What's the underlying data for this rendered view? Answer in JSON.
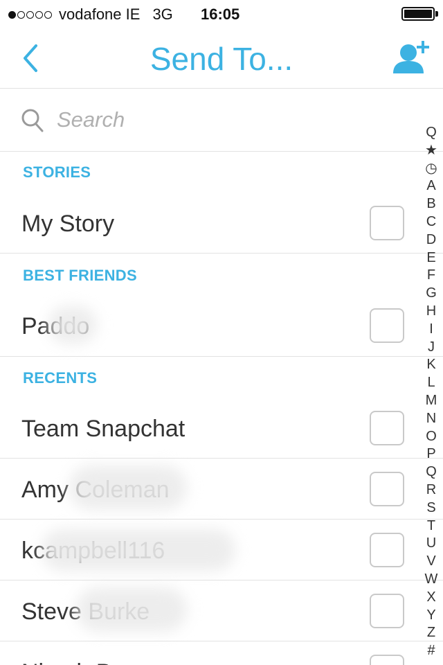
{
  "status_bar": {
    "carrier": "vodafone IE",
    "network": "3G",
    "time": "16:05",
    "signal_bars_filled": 1,
    "signal_bars_total": 5,
    "battery_level": 1.0
  },
  "nav": {
    "title": "Send To...",
    "back_icon": "chevron-left-icon",
    "add_friend_icon": "add-friend-icon"
  },
  "search": {
    "placeholder": "Search",
    "value": ""
  },
  "sections": {
    "stories": {
      "header": "STORIES",
      "items": [
        {
          "label": "My Story",
          "checked": false
        }
      ]
    },
    "best_friends": {
      "header": "BEST FRIENDS",
      "items": [
        {
          "label": "Paddo",
          "checked": false
        }
      ]
    },
    "recents": {
      "header": "RECENTS",
      "items": [
        {
          "label": "Team Snapchat",
          "checked": false
        },
        {
          "label": "Amy Coleman",
          "checked": false
        },
        {
          "label": "kcampbell116",
          "checked": false
        },
        {
          "label": "Steve Burke",
          "checked": false
        },
        {
          "label": "Niamh B",
          "checked": false
        }
      ]
    }
  },
  "index_bar": [
    "Q",
    "★",
    "◷",
    "A",
    "B",
    "C",
    "D",
    "E",
    "F",
    "G",
    "H",
    "I",
    "J",
    "K",
    "L",
    "M",
    "N",
    "O",
    "P",
    "Q",
    "R",
    "S",
    "T",
    "U",
    "V",
    "W",
    "X",
    "Y",
    "Z",
    "#"
  ],
  "colors": {
    "accent": "#3cb2e2",
    "text": "#333333",
    "divider": "#e2e2e2",
    "checkbox_border": "#c9c9c9"
  }
}
